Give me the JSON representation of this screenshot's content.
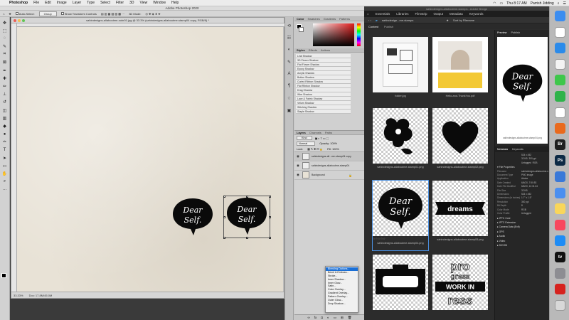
{
  "menubar": {
    "app": "Photoshop",
    "items": [
      "File",
      "Edit",
      "Image",
      "Layer",
      "Type",
      "Select",
      "Filter",
      "3D",
      "View",
      "Window",
      "Help"
    ],
    "status_time": "Thu 8:17 AM",
    "status_user": "Parrish Jidding"
  },
  "photoshop": {
    "title": "Adobe Photoshop 2020",
    "options": {
      "auto_select": "Auto-Select:",
      "group": "Group",
      "show_transform": "Show Transform Controls",
      "mode_3d": "3D Mode:"
    },
    "doc_title": "sahindesigns-allaboutme-sobr01.jpg @ 33.3% (sahindesigns-allaboutme-stamp04 copy, RGB/8) *",
    "zoom": "33.33%",
    "doc_info": "Doc: 17.8M/45.0M",
    "bubble_text_1": "Dear",
    "bubble_text_2": "Self.",
    "tabs_color": [
      "Color",
      "Swatches",
      "Gradients",
      "Patterns"
    ],
    "tabs_styles": [
      "Styles",
      "Effects",
      "Actions"
    ],
    "styles": [
      "Leaf Shadow",
      "3D Flower Shadow",
      "Flat Flower Shadow",
      "Epoxy Shadow",
      "Acrylic Shadow",
      "Button Shadow",
      "Curled Ribbon Shadow",
      "Flat Ribbon Shadow",
      "Drag Shadow",
      "Wire Shadow",
      "Lace & Fabric Shadow",
      "Velum Shadow",
      "Stitching Shadow",
      "Staple Shadow"
    ],
    "tabs_layers": [
      "Layers",
      "Channels",
      "Paths"
    ],
    "layer_kind": "Kind",
    "layer_blend": "Normal",
    "layer_opacity": "Opacity: 100%",
    "layer_lock": "Lock:",
    "layer_fill": "Fill: 100%",
    "layers": [
      "sahindesigns-all...me-stamp04 copy",
      "sahindesigns-allaboutme-stamp04",
      "Background"
    ],
    "context_menu": [
      "Blending Options...",
      "Bevel & Emboss...",
      "Stroke...",
      "Inner Shadow...",
      "Inner Glow...",
      "Satin...",
      "Color Overlay...",
      "Gradient Overlay...",
      "Pattern Overlay...",
      "Outer Glow...",
      "Drop Shadow..."
    ]
  },
  "bridge": {
    "title": "sahindesigns-allaboutme-stamps - Adobe Bridge",
    "menu": [
      "Essentials",
      "Libraries",
      "Filmstrip",
      "Output",
      "Metadata",
      "Keywords"
    ],
    "path": "sahindesign...me-stamps",
    "sort": "Sort by Filename",
    "tabs": [
      "Content",
      "Publish"
    ],
    "thumbs": [
      {
        "name": "folder.jpg"
      },
      {
        "name": "Hello-and-ThankYou.pdf"
      },
      {
        "name": "sahindesigns-allaboutme-stamp01.png"
      },
      {
        "name": "sahindesigns-allaboutme-stamp02.png"
      },
      {
        "name": "sahindesigns-allaboutme-stamp04.png"
      },
      {
        "name": "sahindesigns-allaboutme-stamp05.png"
      },
      {
        "name": "",
        "label": ""
      },
      {
        "name": "",
        "label": "progress"
      }
    ],
    "thumb_dreams": "dreams",
    "progress_words": [
      "pro",
      "gress",
      "WORK IN",
      "ress"
    ],
    "preview_tabs": [
      "Preview",
      "Publish"
    ],
    "preview_name": "sahindesigns-allaboutme-stamp04.png",
    "meta_tabs": [
      "Metadata",
      "Keywords"
    ],
    "meta_quick": [
      [
        "524 x 452",
        ""
      ],
      [
        "32 KB",
        "300 ppi"
      ],
      [
        "Untagged",
        "RGB"
      ]
    ],
    "file_props_title": "File Properties",
    "file_props": [
      [
        "Filename",
        "sahindesigns-allaboutme-stamp04.png"
      ],
      [
        "Document Type",
        "PNG image"
      ],
      [
        "Application",
        "Adobe"
      ],
      [
        "Date Created",
        "6/6/20, 7:50:53"
      ],
      [
        "Date File Modified",
        "6/6/20, 12:31:04"
      ],
      [
        "File Size",
        "32 KB"
      ],
      [
        "Dimensions",
        "524 x 452"
      ],
      [
        "Dimensions (in inches)",
        "1.7\" x 1.5\""
      ],
      [
        "Resolution",
        "300 ppi"
      ],
      [
        "Bit Depth",
        "8"
      ],
      [
        "Color Mode",
        "RGB"
      ],
      [
        "Color Profile",
        "Untagged"
      ]
    ],
    "sections": [
      "IPTC Core",
      "IPTC Extension",
      "Camera Data (Exif)",
      "GPS",
      "Audio",
      "Video",
      "DICOM"
    ]
  },
  "dock": {
    "icons": [
      {
        "name": "finder-icon",
        "color": "#3b8df0",
        "glyph": ""
      },
      {
        "name": "calendar-icon",
        "color": "#ffffff",
        "glyph": ""
      },
      {
        "name": "safari-icon",
        "color": "#2b8bea",
        "glyph": ""
      },
      {
        "name": "photos-icon",
        "color": "#f3f3f3",
        "glyph": ""
      },
      {
        "name": "messages-icon",
        "color": "#3ec74b",
        "glyph": ""
      },
      {
        "name": "facetime-icon",
        "color": "#2fb34a",
        "glyph": ""
      },
      {
        "name": "chrome-icon",
        "color": "#ffffff",
        "glyph": ""
      },
      {
        "name": "firefox-icon",
        "color": "#e96a1e",
        "glyph": ""
      },
      {
        "name": "bridge-icon",
        "color": "#202020",
        "glyph": "Br"
      },
      {
        "name": "photoshop-icon",
        "color": "#0d2a45",
        "glyph": "Ps"
      },
      {
        "name": "finder2-icon",
        "color": "#3a79d8",
        "glyph": ""
      },
      {
        "name": "mail-icon",
        "color": "#4a8ff0",
        "glyph": ""
      },
      {
        "name": "notes-icon",
        "color": "#f9d65a",
        "glyph": ""
      },
      {
        "name": "music-icon",
        "color": "#f8475e",
        "glyph": ""
      },
      {
        "name": "appstore-icon",
        "color": "#1e8cf5",
        "glyph": ""
      },
      {
        "name": "appletv-icon",
        "color": "#111111",
        "glyph": "tv"
      },
      {
        "name": "settings-icon",
        "color": "#8d8d92",
        "glyph": ""
      },
      {
        "name": "acrobat-icon",
        "color": "#d6221e",
        "glyph": ""
      },
      {
        "name": "trash-icon",
        "color": "#d8d8d8",
        "glyph": ""
      }
    ]
  }
}
